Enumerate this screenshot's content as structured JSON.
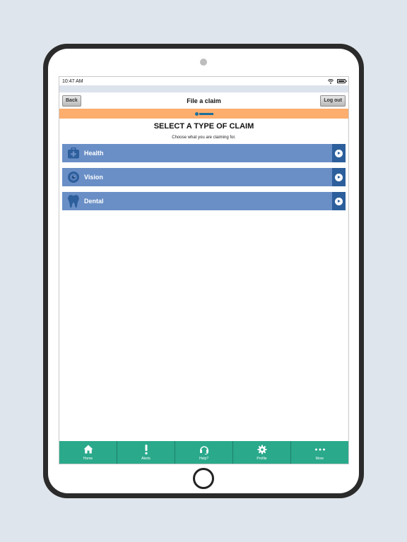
{
  "status_bar": {
    "time": "10:47 AM"
  },
  "nav": {
    "back_label": "Back",
    "title": "File a claim",
    "logout_label": "Log out"
  },
  "colors": {
    "brand_band": "#fdad6d",
    "claim_row": "#6a8fc6",
    "claim_arrow": "#2d5f9c",
    "tab_bar": "#2aa98b"
  },
  "main": {
    "heading": "SELECT A TYPE OF CLAIM",
    "subheading": "Choose what you are claiming for.",
    "claim_types": [
      {
        "label": "Health",
        "icon": "medical-bag-icon"
      },
      {
        "label": "Vision",
        "icon": "eye-icon"
      },
      {
        "label": "Dental",
        "icon": "tooth-icon"
      }
    ]
  },
  "tab_bar": {
    "items": [
      {
        "label": "Home",
        "icon": "home-icon"
      },
      {
        "label": "Alerts",
        "icon": "exclamation-icon"
      },
      {
        "label": "Help?",
        "icon": "headset-icon"
      },
      {
        "label": "Profile",
        "icon": "gear-icon"
      },
      {
        "label": "More",
        "icon": "more-dots-icon"
      }
    ]
  }
}
